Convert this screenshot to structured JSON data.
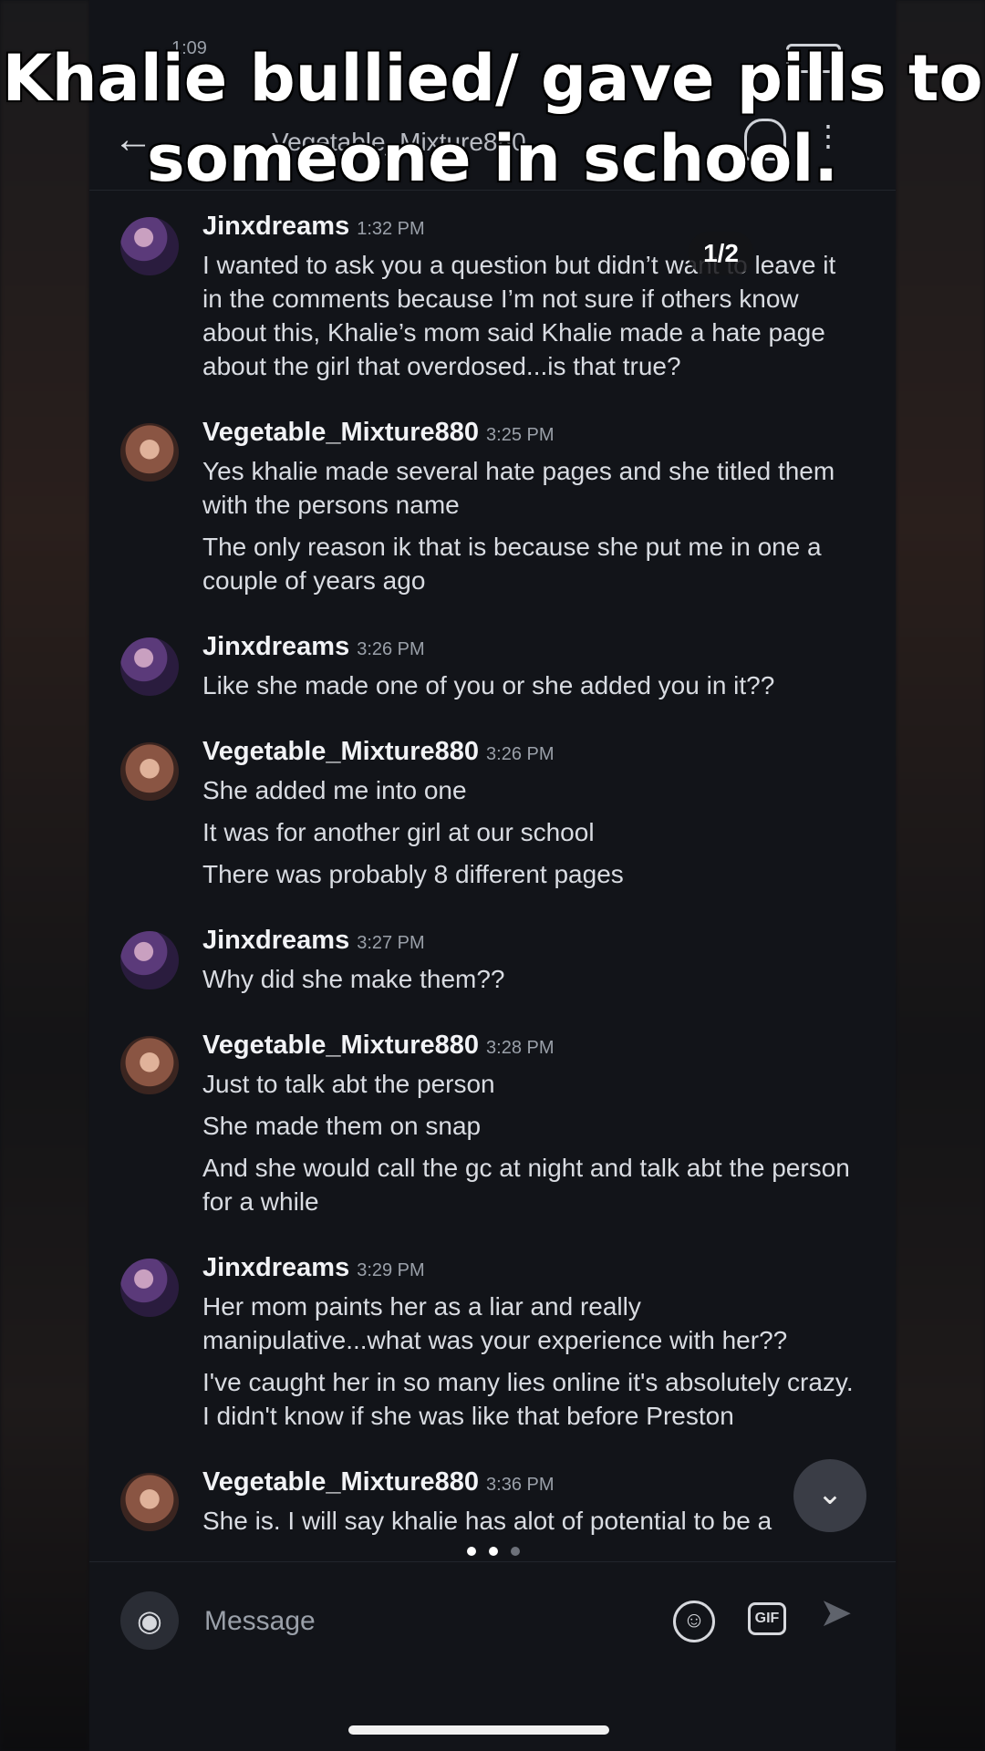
{
  "overlay": {
    "caption": "Khalie bullied/ gave pills to someone in school.",
    "page_indicator": "1/2"
  },
  "status_bar": {
    "time": "1:09"
  },
  "topbar": {
    "conversation_name": "Vegetable_Mixture880"
  },
  "messages": [
    {
      "user": "Jinxdreams",
      "time": "1:32 PM",
      "avatar": "avatar-jinx",
      "lines": [
        "I wanted to ask you a question but didn’t want to leave it in the comments because I’m not sure if others know about this, Khalie’s mom said Khalie made a hate page about the girl that overdosed...is that true?"
      ]
    },
    {
      "user": "Vegetable_Mixture880",
      "time": "3:25 PM",
      "avatar": "avatar-veg",
      "lines": [
        "Yes khalie made several hate pages and she titled them with the persons name",
        "The only reason ik that is because she put me in one a couple of years ago"
      ]
    },
    {
      "user": "Jinxdreams",
      "time": "3:26 PM",
      "avatar": "avatar-jinx",
      "lines": [
        "Like she made one of you or she added you in it??"
      ]
    },
    {
      "user": "Vegetable_Mixture880",
      "time": "3:26 PM",
      "avatar": "avatar-veg",
      "lines": [
        "She added me into one",
        "It was for another girl at our school",
        "There was probably 8 different pages"
      ]
    },
    {
      "user": "Jinxdreams",
      "time": "3:27 PM",
      "avatar": "avatar-jinx",
      "lines": [
        "Why did she make them??"
      ]
    },
    {
      "user": "Vegetable_Mixture880",
      "time": "3:28 PM",
      "avatar": "avatar-veg",
      "lines": [
        "Just to talk abt the person",
        "She made them on snap",
        "And she would call the gc at night and talk abt the person for a while"
      ]
    },
    {
      "user": "Jinxdreams",
      "time": "3:29 PM",
      "avatar": "avatar-jinx",
      "lines": [
        "Her mom paints her as a liar and really manipulative...what was your experience with her??",
        "I've caught her in so many lies online it's absolutely crazy. I didn't know if she was like that before Preston"
      ]
    },
    {
      "user": "Vegetable_Mixture880",
      "time": "3:36 PM",
      "avatar": "avatar-veg",
      "lines": [
        "She is. I will say khalie has alot of potential to be a"
      ]
    }
  ],
  "composer": {
    "placeholder": "Message",
    "gif_label": "GIF"
  },
  "icons": {
    "back": "back-arrow-icon",
    "bell": "bell-icon",
    "more": "more-icon",
    "camera": "camera-icon",
    "emoji": "emoji-icon",
    "gif": "gif-icon",
    "send": "send-icon",
    "scroll_down": "chevron-down-icon"
  }
}
